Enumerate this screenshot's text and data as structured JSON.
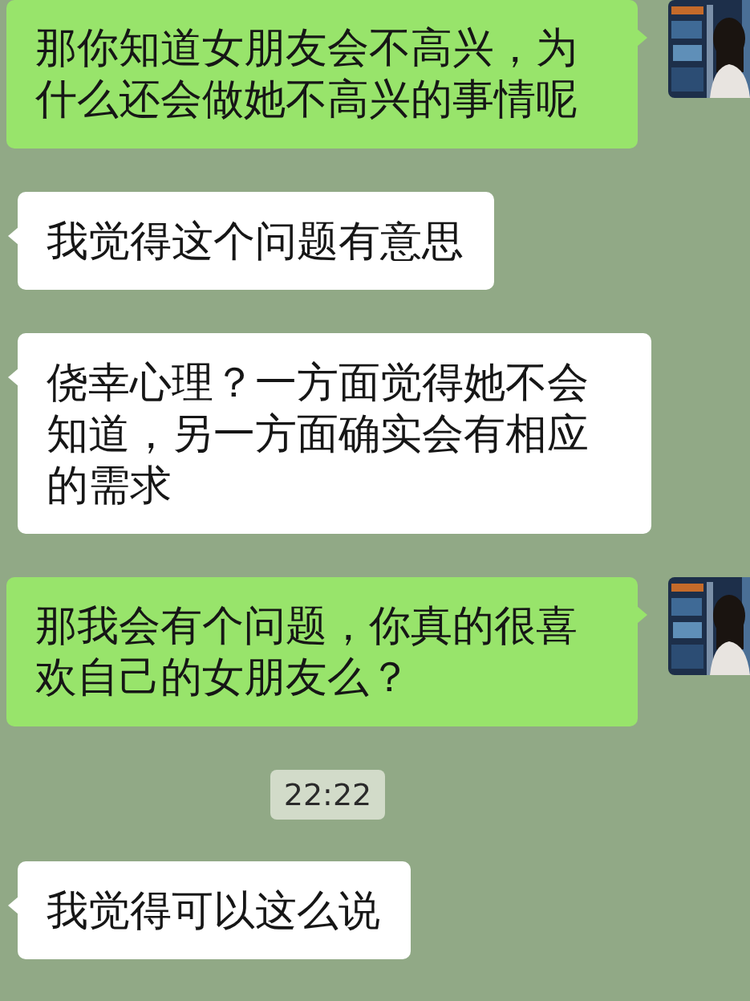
{
  "messages": [
    {
      "kind": "outgoing",
      "text": "那你知道女朋友会不高兴，为什么还会做她不高兴的事情呢"
    },
    {
      "kind": "incoming",
      "text": "我觉得这个问题有意思"
    },
    {
      "kind": "incoming",
      "text": "侥幸心理？一方面觉得她不会知道，另一方面确实会有相应的需求"
    },
    {
      "kind": "outgoing",
      "text": "那我会有个问题，你真的很喜欢自己的女朋友么？"
    },
    {
      "kind": "timestamp",
      "text": "22:22"
    },
    {
      "kind": "incoming",
      "text": "我觉得可以这么说"
    }
  ]
}
